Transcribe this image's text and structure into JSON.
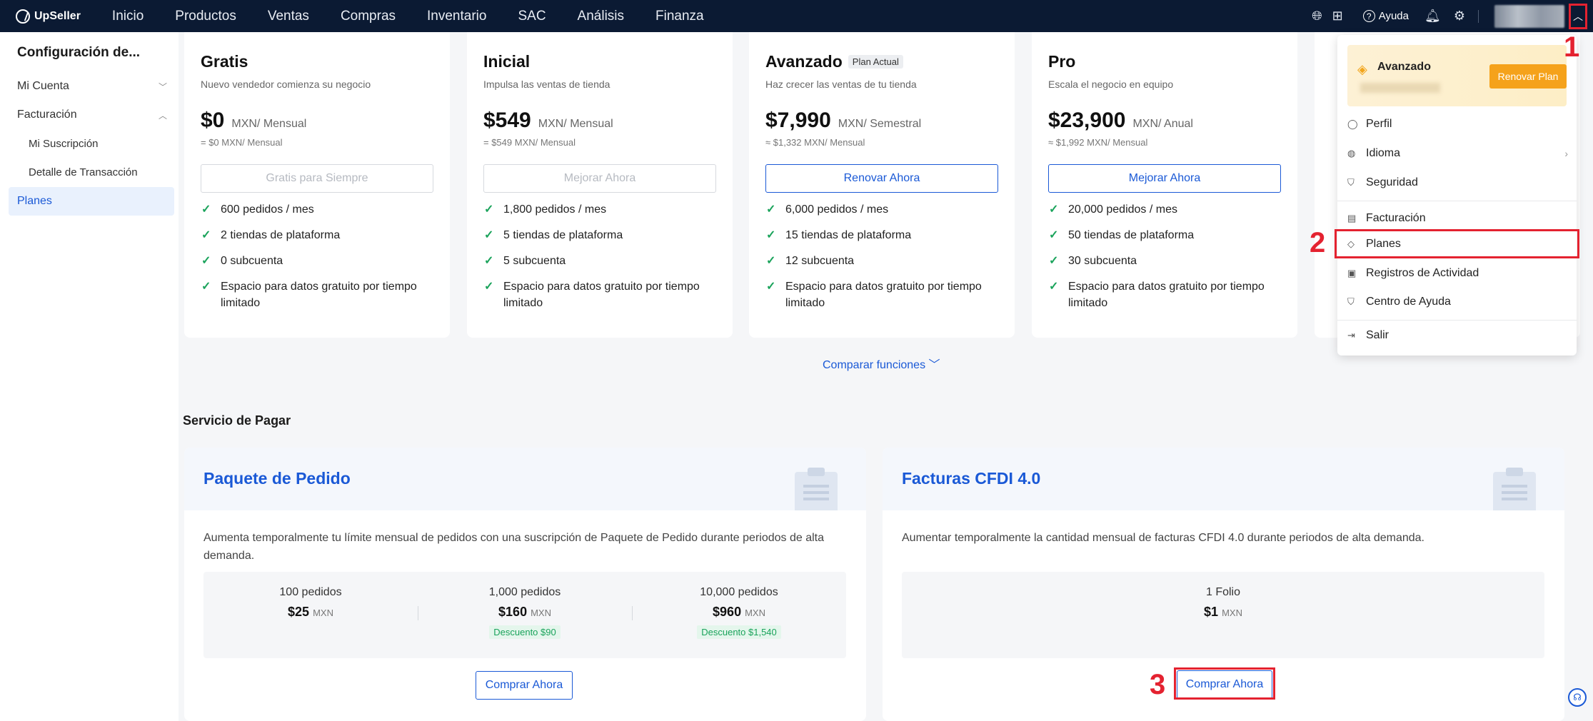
{
  "app": {
    "logo": "UpSeller"
  },
  "nav": [
    "Inicio",
    "Productos",
    "Ventas",
    "Compras",
    "Inventario",
    "SAC",
    "Análisis",
    "Finanza"
  ],
  "topbar": {
    "help_label": "Ayuda"
  },
  "sidebar": {
    "title": "Configuración de...",
    "items": {
      "mi_cuenta": "Mi Cuenta",
      "facturacion": "Facturación",
      "mi_suscripcion": "Mi Suscripción",
      "detalle": "Detalle de Transacción",
      "planes": "Planes"
    }
  },
  "plans": [
    {
      "name": "Gratis",
      "badge": "",
      "desc": "Nuevo vendedor comienza su negocio",
      "price": "$0",
      "unit": "MXN/ Mensual",
      "equiv": "= $0 MXN/ Mensual",
      "button": "Gratis para Siempre",
      "features": [
        "600 pedidos / mes",
        "2 tiendas de plataforma",
        "0 subcuenta",
        "Espacio para datos gratuito por tiempo limitado"
      ]
    },
    {
      "name": "Inicial",
      "badge": "",
      "desc": "Impulsa las ventas de tienda",
      "price": "$549",
      "unit": "MXN/ Mensual",
      "equiv": "= $549 MXN/ Mensual",
      "button": "Mejorar Ahora",
      "features": [
        "1,800 pedidos / mes",
        "5 tiendas de plataforma",
        "5 subcuenta",
        "Espacio para datos gratuito por tiempo limitado"
      ]
    },
    {
      "name": "Avanzado",
      "badge": "Plan Actual",
      "desc": "Haz crecer las ventas de tu tienda",
      "price": "$7,990",
      "unit": "MXN/ Semestral",
      "equiv": "≈ $1,332 MXN/ Mensual",
      "button": "Renovar Ahora",
      "features": [
        "6,000 pedidos / mes",
        "15 tiendas de plataforma",
        "12 subcuenta",
        "Espacio para datos gratuito por tiempo limitado"
      ]
    },
    {
      "name": "Pro",
      "badge": "",
      "desc": "Escala el negocio en equipo",
      "price": "$23,900",
      "unit": "MXN/ Anual",
      "equiv": "≈ $1,992 MXN/ Mensual",
      "button": "Mejorar Ahora",
      "features": [
        "20,000 pedidos / mes",
        "50 tiendas de plataforma",
        "30 subcuenta",
        "Espacio para datos gratuito por tiempo limitado"
      ]
    }
  ],
  "compare_label": "Comparar funciones",
  "section_title": "Servicio de Pagar",
  "services": {
    "pedido": {
      "title": "Paquete de Pedido",
      "desc": "Aumenta temporalmente tu límite mensual de pedidos con una suscripción de Paquete de Pedido durante periodos de alta demanda.",
      "tiers": [
        {
          "qty": "100 pedidos",
          "price": "$25",
          "cur": "MXN",
          "discount": ""
        },
        {
          "qty": "1,000 pedidos",
          "price": "$160",
          "cur": "MXN",
          "discount": "Descuento $90"
        },
        {
          "qty": "10,000 pedidos",
          "price": "$960",
          "cur": "MXN",
          "discount": "Descuento $1,540"
        }
      ],
      "buy_label": "Comprar Ahora"
    },
    "cfdi": {
      "title": "Facturas CFDI 4.0",
      "desc": "Aumentar temporalmente la cantidad mensual de facturas CFDI 4.0 durante periodos de alta demanda.",
      "tiers": [
        {
          "qty": "1 Folio",
          "price": "$1",
          "cur": "MXN",
          "discount": ""
        }
      ],
      "buy_label": "Comprar Ahora"
    }
  },
  "dropdown": {
    "plan_name": "Avanzado",
    "renew_label": "Renovar Plan",
    "items": {
      "perfil": "Perfil",
      "idioma": "Idioma",
      "seguridad": "Seguridad",
      "facturacion": "Facturación",
      "planes": "Planes",
      "registros": "Registros de Actividad",
      "centro": "Centro de Ayuda",
      "salir": "Salir"
    }
  },
  "annotations": [
    "1",
    "2",
    "3"
  ],
  "colors": {
    "accent": "#1a59d6",
    "nav_bg": "#0b1a33",
    "annotation": "#e42230",
    "check": "#1aa35b",
    "renew": "#f5a21b"
  }
}
